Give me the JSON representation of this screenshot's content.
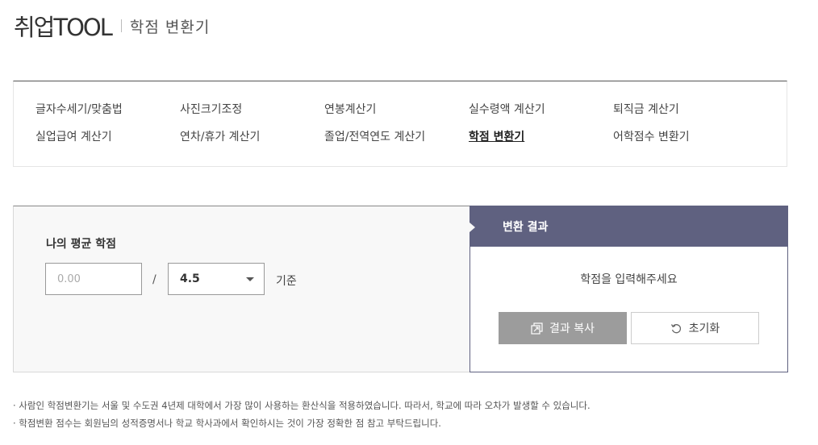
{
  "header": {
    "logo": "취업TOOL",
    "title": "학점 변환기"
  },
  "menu": {
    "items": [
      {
        "label": "글자수세기/맞춤법",
        "active": false
      },
      {
        "label": "사진크기조정",
        "active": false
      },
      {
        "label": "연봉계산기",
        "active": false
      },
      {
        "label": "실수령액 계산기",
        "active": false
      },
      {
        "label": "퇴직금 계산기",
        "active": false
      },
      {
        "label": "실업급여 계산기",
        "active": false
      },
      {
        "label": "연차/휴가 계산기",
        "active": false
      },
      {
        "label": "졸업/전역연도 계산기",
        "active": false
      },
      {
        "label": "학점 변환기",
        "active": true
      },
      {
        "label": "어학점수 변환기",
        "active": false
      }
    ]
  },
  "calculator": {
    "label": "나의 평균 학점",
    "score_placeholder": "0.00",
    "slash": "/",
    "scale_selected": "4.5",
    "basis_label": "기준"
  },
  "result": {
    "header": "변환 결과",
    "message": "학점을 입력해주세요",
    "copy_button": "결과 복사",
    "reset_button": "초기화"
  },
  "notes": [
    "· 사람인 학점변환기는 서울 및 수도권 4년제 대학에서 가장 많이 사용하는 환산식을 적용하였습니다. 따라서, 학교에 따라 오차가 발생할 수 있습니다.",
    "· 학점변환 점수는 회원님의 성적증명서나 학교 학사과에서 확인하시는 것이 가장 정확한 점 참고 부탁드립니다."
  ],
  "colors": {
    "result_header_bg": "#5f6180",
    "copy_button_bg": "#9c9c9c"
  }
}
